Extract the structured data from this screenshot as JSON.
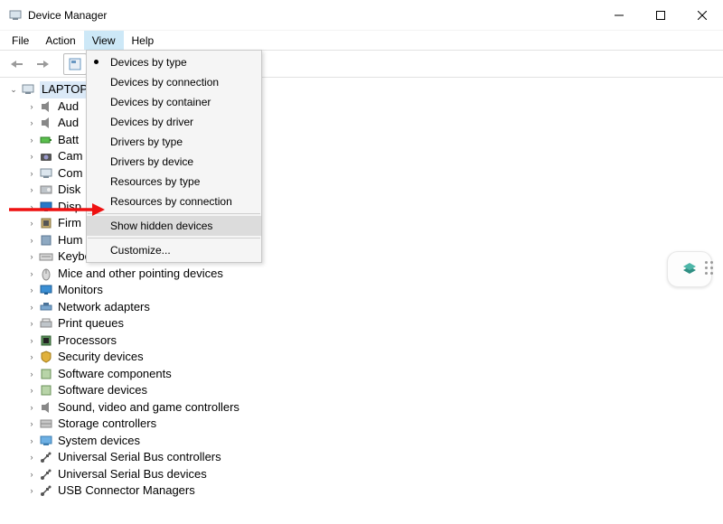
{
  "window": {
    "title": "Device Manager"
  },
  "menubar": {
    "items": [
      "File",
      "Action",
      "View",
      "Help"
    ],
    "open_index": 2
  },
  "tree": {
    "root": {
      "label": "LAPTOP-"
    },
    "children": [
      {
        "label": "Aud",
        "icon": "speaker"
      },
      {
        "label": "Aud",
        "icon": "speaker"
      },
      {
        "label": "Batt",
        "icon": "battery"
      },
      {
        "label": "Cam",
        "icon": "camera"
      },
      {
        "label": "Com",
        "icon": "computer"
      },
      {
        "label": "Disk",
        "icon": "disk"
      },
      {
        "label": "Disp",
        "icon": "display"
      },
      {
        "label": "Firm",
        "icon": "chip"
      },
      {
        "label": "Hum",
        "icon": "hid"
      },
      {
        "label": "Keyboards",
        "icon": "keyboard"
      },
      {
        "label": "Mice and other pointing devices",
        "icon": "mouse"
      },
      {
        "label": "Monitors",
        "icon": "monitor"
      },
      {
        "label": "Network adapters",
        "icon": "network"
      },
      {
        "label": "Print queues",
        "icon": "printer"
      },
      {
        "label": "Processors",
        "icon": "cpu"
      },
      {
        "label": "Security devices",
        "icon": "security"
      },
      {
        "label": "Software components",
        "icon": "component"
      },
      {
        "label": "Software devices",
        "icon": "component"
      },
      {
        "label": "Sound, video and game controllers",
        "icon": "speaker"
      },
      {
        "label": "Storage controllers",
        "icon": "storage"
      },
      {
        "label": "System devices",
        "icon": "system"
      },
      {
        "label": "Universal Serial Bus controllers",
        "icon": "usb"
      },
      {
        "label": "Universal Serial Bus devices",
        "icon": "usb"
      },
      {
        "label": "USB Connector Managers",
        "icon": "usb"
      }
    ]
  },
  "view_menu": {
    "items": [
      {
        "label": "Devices by type",
        "checked": true
      },
      {
        "label": "Devices by connection"
      },
      {
        "label": "Devices by container"
      },
      {
        "label": "Devices by driver"
      },
      {
        "label": "Drivers by type"
      },
      {
        "label": "Drivers by device"
      },
      {
        "label": "Resources by type"
      },
      {
        "label": "Resources by connection"
      },
      {
        "sep": true
      },
      {
        "label": "Show hidden devices",
        "highlighted": true
      },
      {
        "sep": true
      },
      {
        "label": "Customize..."
      }
    ]
  }
}
